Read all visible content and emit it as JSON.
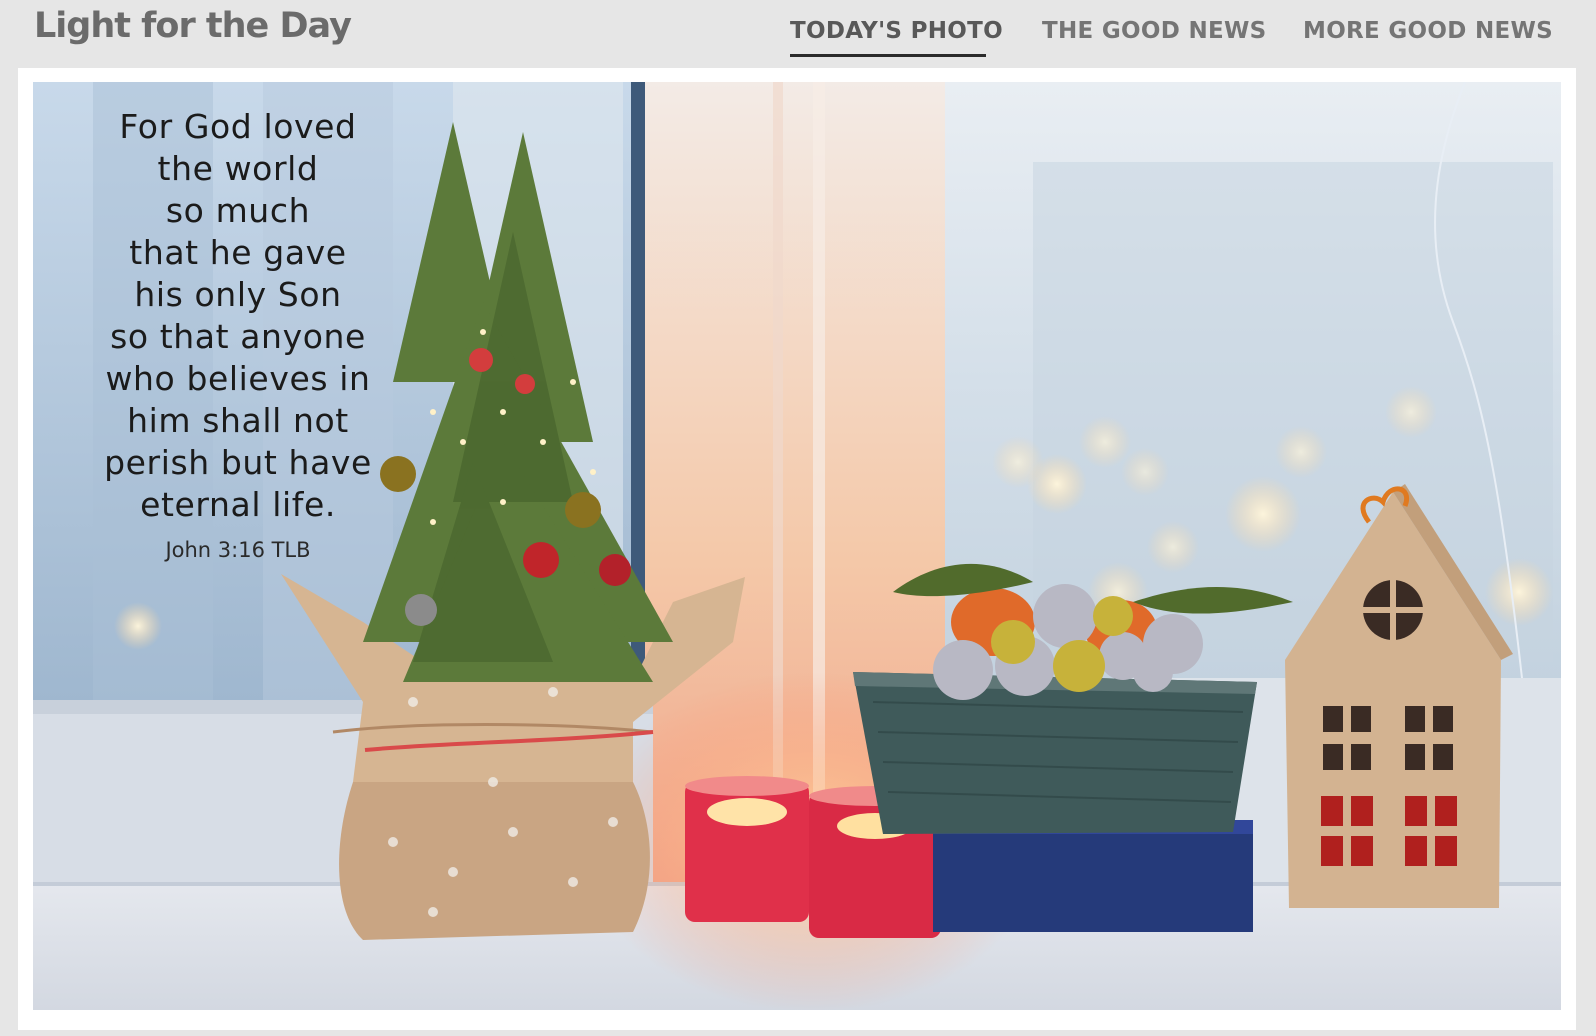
{
  "site": {
    "title": "Light for the Day"
  },
  "nav": {
    "items": [
      {
        "label": "TODAY'S PHOTO",
        "active": true
      },
      {
        "label": "THE GOOD NEWS",
        "active": false
      },
      {
        "label": "MORE GOOD NEWS",
        "active": false
      }
    ]
  },
  "photo": {
    "verse": "For God loved\nthe world\nso much\nthat he gave\nhis only Son\nso that anyone\nwho believes in\nhim shall not\nperish but have\neternal life.",
    "reference": "John 3:16 TLB"
  },
  "colors": {
    "page_bg": "#e6e6e6",
    "title": "#6b6b6b",
    "nav_text": "#757575",
    "nav_active_underline": "#2b2b2b",
    "candle_red": "#e0304a",
    "basket": "#3f5a5a",
    "box_blue": "#253a7a",
    "kraft": "#c9a583"
  }
}
